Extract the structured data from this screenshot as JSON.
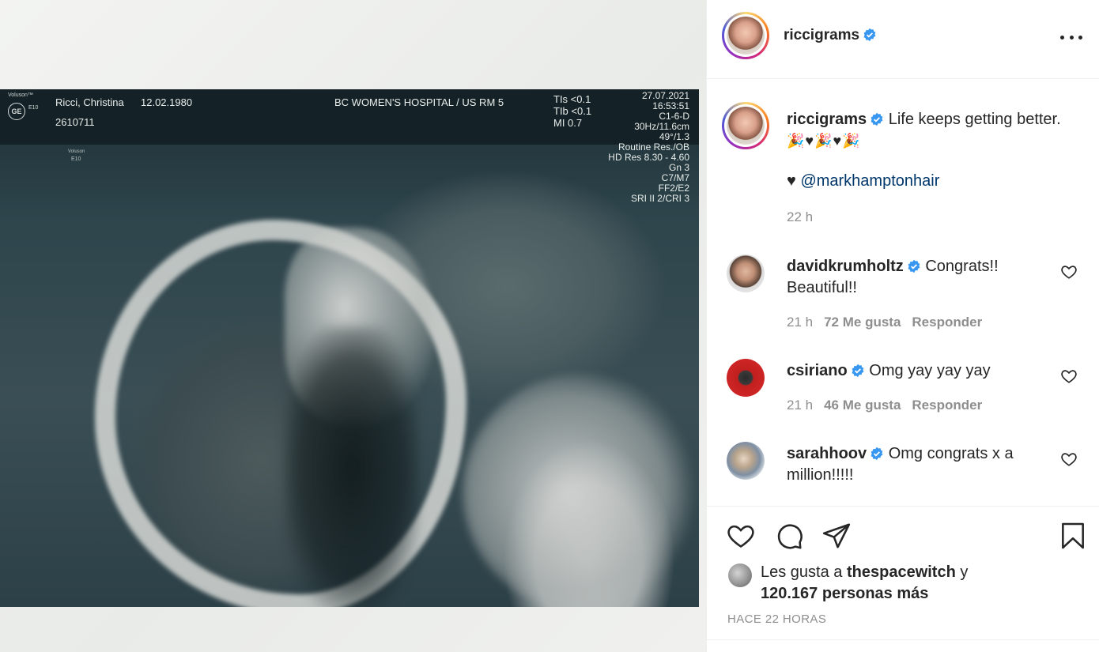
{
  "ultrasound": {
    "brand_tag": "Voluson™",
    "logo": "GE",
    "model_a": "E10",
    "model_b_brand": "Voluson",
    "model_b": "E10",
    "patient_name": "Ricci, Christina",
    "patient_dob": "12.02.1980",
    "patient_id": "2610711",
    "hospital": "BC WOMEN'S HOSPITAL / US RM 5",
    "params_left": [
      "TIs <0.1",
      "TIb <0.1",
      "MI  0.7"
    ],
    "params_right": [
      "27.07.2021",
      "16:53:51",
      "C1-6-D",
      "30Hz/11.6cm",
      "49°/1.3",
      "Routine Res./OB",
      "HD Res 8.30 - 4.60",
      "Gn  3",
      "C7/M7",
      "FF2/E2",
      "SRI II 2/CRI 3"
    ]
  },
  "header": {
    "username": "riccigrams",
    "verified": true,
    "more_icon": "more-horizontal-icon"
  },
  "caption": {
    "username": "riccigrams",
    "text": "Life keeps getting better.",
    "emoji_line": "🎉♥🎉♥🎉",
    "mention_prefix": "♥",
    "mention": "@markhamptonhair",
    "time": "22 h"
  },
  "comments": [
    {
      "username": "davidkrumholtz",
      "text": "Congrats!! Beautiful!!",
      "time": "21 h",
      "likes": "72 Me gusta",
      "reply": "Responder"
    },
    {
      "username": "csiriano",
      "text": "Omg yay yay yay",
      "time": "21 h",
      "likes": "46 Me gusta",
      "reply": "Responder"
    },
    {
      "username": "sarahhoov",
      "text": "Omg congrats x a million!!!!!",
      "time": "",
      "likes": "",
      "reply": ""
    }
  ],
  "actions": {
    "icons": [
      "heart-icon",
      "comment-icon",
      "share-icon",
      "bookmark-icon"
    ],
    "likes_prefix": "Les gusta a",
    "likes_user": "thespacewitch",
    "likes_conj": "y",
    "likes_count": "120.167 personas más",
    "posted": "HACE 22 HORAS"
  },
  "colors": {
    "verified": "#3897f0",
    "mention": "#00376b",
    "secondary_text": "#8e8e8e"
  }
}
